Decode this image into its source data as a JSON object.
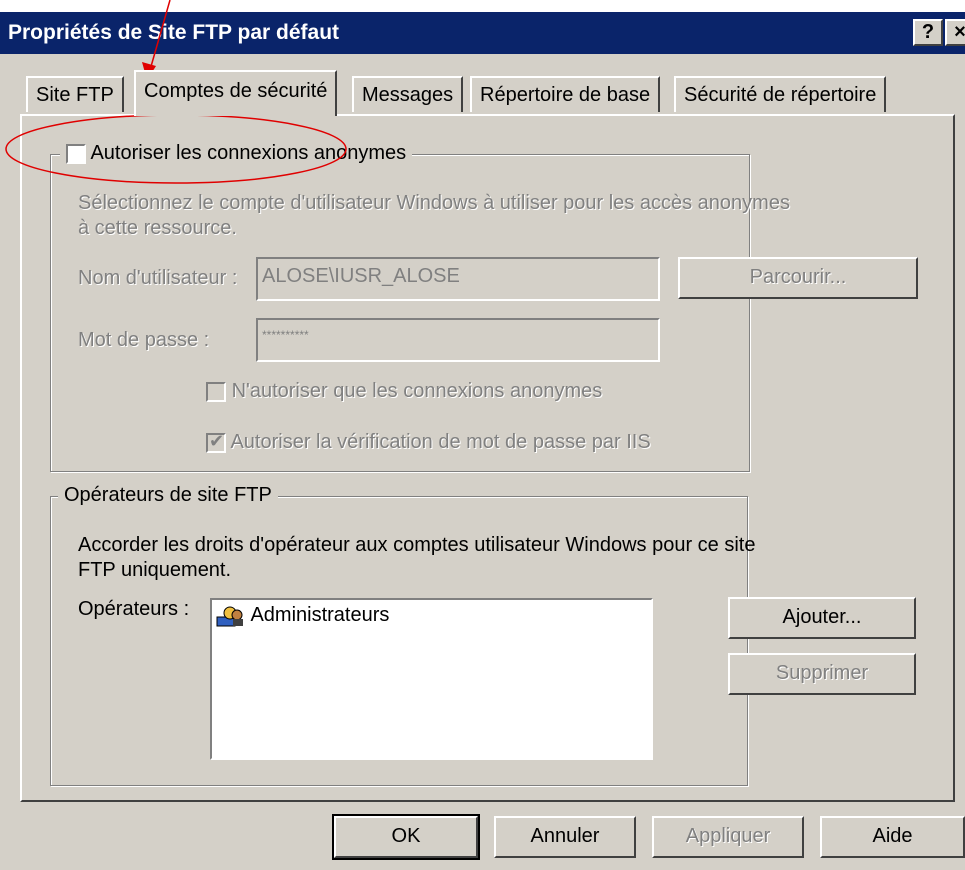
{
  "window": {
    "title": "Propriétés de Site FTP par défaut",
    "help_label": "?",
    "close_label": "×"
  },
  "tabs": [
    {
      "label": "Site FTP"
    },
    {
      "label": "Comptes de sécurité",
      "active": true
    },
    {
      "label": "Messages"
    },
    {
      "label": "Répertoire de base"
    },
    {
      "label": "Sécurité de répertoire"
    }
  ],
  "anonymous": {
    "checkbox_label": "Autoriser les connexions anonymes",
    "checked": false,
    "description_line1": "Sélectionnez le compte d'utilisateur Windows à utiliser pour les accès anonymes",
    "description_line2": "à cette ressource.",
    "username_label": "Nom d'utilisateur :",
    "username_value": "ALOSE\\IUSR_ALOSE",
    "browse_label": "Parcourir...",
    "password_label": "Mot de passe :",
    "password_value": "**********",
    "only_anonymous_label": "N'autoriser que les connexions anonymes",
    "only_anonymous_checked": false,
    "iis_password_label": "Autoriser la vérification de mot de passe par IIS",
    "iis_password_checked": true
  },
  "operators": {
    "group_label": "Opérateurs de site FTP",
    "description_line1": "Accorder les droits d'opérateur aux comptes utilisateur Windows pour ce site",
    "description_line2": "FTP uniquement.",
    "list_label": "Opérateurs :",
    "items": [
      "Administrateurs"
    ],
    "add_label": "Ajouter...",
    "remove_label": "Supprimer"
  },
  "footer": {
    "ok_label": "OK",
    "cancel_label": "Annuler",
    "apply_label": "Appliquer",
    "help_label": "Aide"
  },
  "colors": {
    "titlebar": "#0a246a",
    "face": "#d4d0c8",
    "annotation": "#e00000"
  }
}
